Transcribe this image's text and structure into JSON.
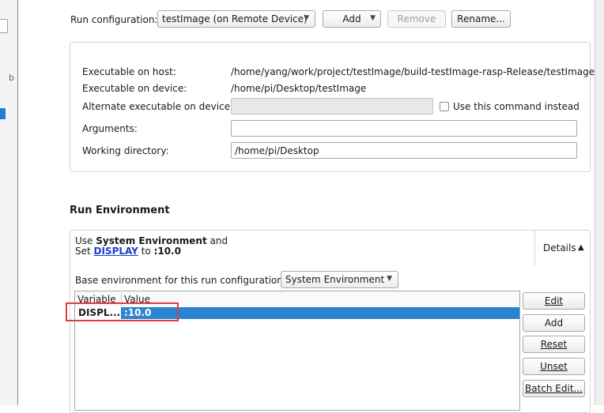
{
  "sidebar_stub": {
    "text_fragment": "b"
  },
  "run_config": {
    "label": "Run configuration:",
    "selected": "testImage (on Remote Device)",
    "add_label": "Add",
    "remove_label": "Remove",
    "rename_label": "Rename..."
  },
  "exec": {
    "host_label": "Executable on host:",
    "host_value": "/home/yang/work/project/testImage/build-testImage-rasp-Release/testImage",
    "device_label": "Executable on device:",
    "device_value": "/home/pi/Desktop/testImage",
    "alt_label": "Alternate executable on device:",
    "alt_value": "",
    "use_cmd_label": "Use this command instead",
    "args_label": "Arguments:",
    "args_value": "",
    "workdir_label": "Working directory:",
    "workdir_value": "/home/pi/Desktop"
  },
  "run_env": {
    "title": "Run Environment",
    "summary": {
      "use": "Use ",
      "sys_env": "System Environment",
      "and": " and",
      "set": "Set ",
      "var": "DISPLAY",
      "to": " to ",
      "value": ":10.0"
    },
    "details_label": "Details",
    "base_label": "Base environment for this run configuration:",
    "base_selected": "System Environment",
    "table": {
      "columns": [
        "Variable",
        "Value"
      ],
      "rows": [
        {
          "variable": "DISPL...",
          "value": ":10.0"
        }
      ]
    },
    "buttons": {
      "edit": "Edit",
      "add": "Add",
      "reset": "Reset",
      "unset": "Unset",
      "batch": "Batch Edit..."
    }
  },
  "colors": {
    "selection": "#2b84d1",
    "highlight_box": "#e03c3c",
    "link": "#1a3fcc"
  }
}
